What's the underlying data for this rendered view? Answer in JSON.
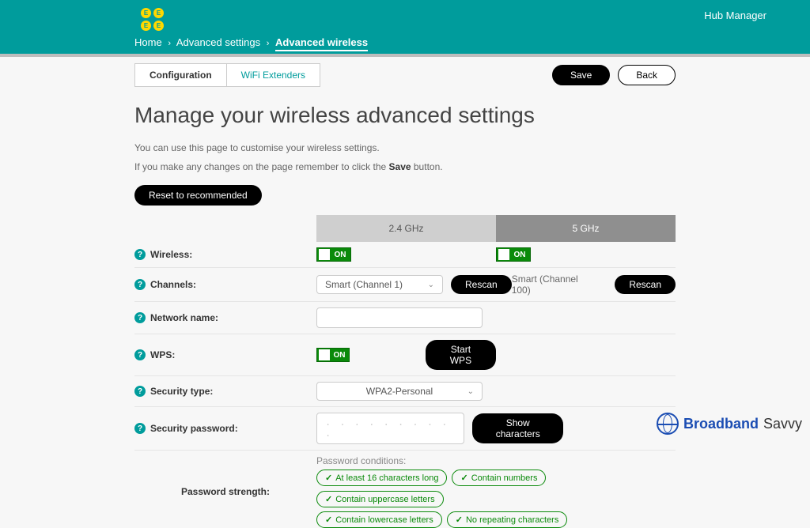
{
  "header": {
    "app_title": "Hub Manager",
    "breadcrumb": {
      "home": "Home",
      "advanced": "Advanced settings",
      "current": "Advanced wireless"
    }
  },
  "topbar": {
    "tabs": {
      "config": "Configuration",
      "ext": "WiFi Extenders"
    },
    "save": "Save",
    "back": "Back"
  },
  "page": {
    "title": "Manage your wireless advanced settings",
    "desc1": "You can use this page to customise your wireless settings.",
    "desc2_pre": "If you make any changes on the page remember to click the ",
    "desc2_bold": "Save",
    "desc2_post": " button.",
    "reset": "Reset to recommended"
  },
  "bands": {
    "b24": "2.4 GHz",
    "b5": "5 GHz"
  },
  "labels": {
    "wireless": "Wireless:",
    "channels": "Channels:",
    "netname": "Network name:",
    "wps": "WPS:",
    "sectype": "Security type:",
    "secpwd": "Security password:",
    "pwdstrength": "Password strength:",
    "conditions": "Password conditions:"
  },
  "toggle_on": "ON",
  "channels": {
    "value24": "Smart (Channel 1)",
    "value5": "Smart (Channel 100)",
    "rescan": "Rescan"
  },
  "wps": {
    "start": "Start WPS"
  },
  "sectype": {
    "value": "WPA2-Personal"
  },
  "secpwd": {
    "show": "Show characters",
    "value": ". . . . . . . . . ."
  },
  "conditions": {
    "c1": "At least 16 characters long",
    "c2": "Contain numbers",
    "c3": "Contain uppercase letters",
    "c4": "Contain lowercase letters",
    "c5": "No repeating characters"
  },
  "watermark": {
    "t1": "Broadband",
    "t2": "Savvy"
  }
}
